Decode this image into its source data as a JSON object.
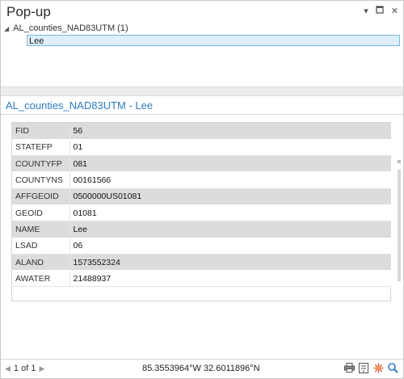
{
  "pane": {
    "title": "Pop-up"
  },
  "window_buttons": {
    "dropdown": "▾",
    "maximize": "▫",
    "close": "✕"
  },
  "tree": {
    "layer_label": "AL_counties_NAD83UTM (1)",
    "feature_label": "Lee"
  },
  "popup": {
    "header": "AL_counties_NAD83UTM - Lee"
  },
  "attributes": [
    {
      "field": "FID",
      "value": "56"
    },
    {
      "field": "STATEFP",
      "value": "01"
    },
    {
      "field": "COUNTYFP",
      "value": "081"
    },
    {
      "field": "COUNTYNS",
      "value": "00161566"
    },
    {
      "field": "AFFGEOID",
      "value": "0500000US01081"
    },
    {
      "field": "GEOID",
      "value": "01081"
    },
    {
      "field": "NAME",
      "value": "Lee"
    },
    {
      "field": "LSAD",
      "value": "06"
    },
    {
      "field": "ALAND",
      "value": "1573552324"
    },
    {
      "field": "AWATER",
      "value": "21488937"
    }
  ],
  "footer": {
    "page_indicator": "1 of 1",
    "coordinates": "85.3553964°W 32.6011896°N"
  },
  "toolbar_icons": [
    "print-icon",
    "export-icon",
    "flash-icon",
    "zoom-to-icon"
  ],
  "colors": {
    "accent": "#2e7bbf",
    "selection_fill": "#dceffb",
    "selection_border": "#7ab7e0",
    "row_shade": "#dcdcdc"
  }
}
